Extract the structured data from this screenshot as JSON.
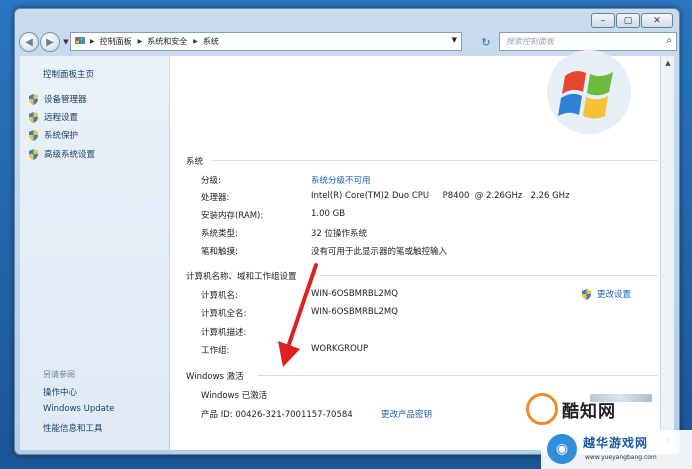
{
  "window": {
    "caption_buttons": [
      "–",
      "▢",
      "✕"
    ],
    "address": {
      "crumbs": [
        "控制面板",
        "系统和安全",
        "系统"
      ]
    },
    "search_placeholder": "搜索控制面板"
  },
  "sidebar": {
    "title": "控制面板主页",
    "links": [
      "设备管理器",
      "远程设置",
      "系统保护",
      "高级系统设置"
    ],
    "see_also_header": "另请参阅",
    "see_also": [
      "操作中心",
      "Windows Update",
      "性能信息和工具"
    ]
  },
  "system_section": {
    "header": "系统",
    "rows": [
      {
        "label": "分级:",
        "value": "系统分级不可用",
        "link": true
      },
      {
        "label": "处理器:",
        "value": "Intel(R) Core(TM)2 Duo CPU     P8400  @ 2.26GHz   2.26 GHz",
        "link": false
      },
      {
        "label": "安装内存(RAM):",
        "value": "1.00 GB",
        "link": false
      },
      {
        "label": "系统类型:",
        "value": "32 位操作系统",
        "link": false
      },
      {
        "label": "笔和触摸:",
        "value": "没有可用于此显示器的笔或触控输入",
        "link": false
      }
    ]
  },
  "computer_section": {
    "header": "计算机名称、域和工作组设置",
    "change_settings": "更改设置",
    "rows": [
      {
        "label": "计算机名:",
        "value": "WIN-6OSBMRBL2MQ"
      },
      {
        "label": "计算机全名:",
        "value": "WIN-6OSBMRBL2MQ"
      },
      {
        "label": "计算机描述:",
        "value": ""
      },
      {
        "label": "工作组:",
        "value": "WORKGROUP"
      }
    ]
  },
  "activation_section": {
    "header": "Windows 激活",
    "status": "Windows 已激活",
    "product_id": "产品 ID: 00426-321-7001157-70584",
    "change_key": "更改产品密钥"
  },
  "watermarks": {
    "brand1": "酷知网",
    "brand2": "越华游戏网",
    "url": "www.yueyangbang.com"
  },
  "colors": {
    "link": "#1a5fb4",
    "accent_arrow": "#e02020"
  }
}
